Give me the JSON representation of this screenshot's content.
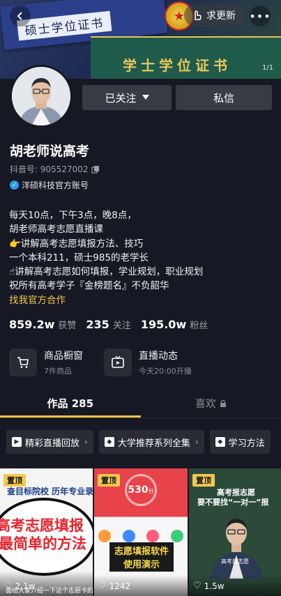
{
  "banner": {
    "cert_top_text": "硕士学位证书",
    "cert_bottom_text": "学士学位证书",
    "request_update_label": "求更新",
    "page_indicator": "1/1"
  },
  "profile": {
    "follow_label": "已关注",
    "message_label": "私信",
    "name": "胡老师说高考",
    "douyin_id": "抖音号: 905527002",
    "verified_label": "洋硕科技官方账号",
    "bio_lines": [
      "每天10点，下午3点，晚8点，",
      "胡老师高考志愿直播课",
      "👉讲解高考志愿填报方法、技巧",
      "一个本科211，硕士985的老学长",
      "☝讲解高考志愿如何填报，学业规划，职业规划",
      "祝所有高考学子『金榜题名』不负韶华"
    ],
    "bio_link": "找我官方合作"
  },
  "stats": [
    {
      "num": "859.2w",
      "label": "获赞"
    },
    {
      "num": "235",
      "label": "关注"
    },
    {
      "num": "195.0w",
      "label": "粉丝"
    }
  ],
  "shortcuts": {
    "shop_title": "商品橱窗",
    "shop_sub": "7件商品",
    "live_title": "直播动态",
    "live_sub": "今天20:00开播"
  },
  "tabs": {
    "works_label": "作品 285",
    "likes_label": "喜欢"
  },
  "chips": [
    {
      "label": "精彩直播回放"
    },
    {
      "label": "大学推荐系列全集"
    },
    {
      "label": "学习方法"
    }
  ],
  "videos": [
    {
      "pin": "置顶",
      "top_text": "查目标院校 历年专业录",
      "title1": "高考志愿填报",
      "title2": "最简单的方法",
      "caption": "面给大家介绍一下这个志愿卡的",
      "likes": "2.1w"
    },
    {
      "pin": "置顶",
      "score": "530",
      "score_unit": "分",
      "overlay1": "志愿填报软件",
      "overlay2": "使用演示",
      "likes": "1242"
    },
    {
      "pin": "置顶",
      "line1": "高考报志愿",
      "line2": "要不要找“一对一”报",
      "caption": "高考报志愿",
      "likes": "1.5w"
    }
  ],
  "colors": {
    "background": "#161823",
    "accent_yellow": "#f6c84a",
    "button_gray": "#393b44",
    "verified_blue": "#2c9cf2"
  }
}
